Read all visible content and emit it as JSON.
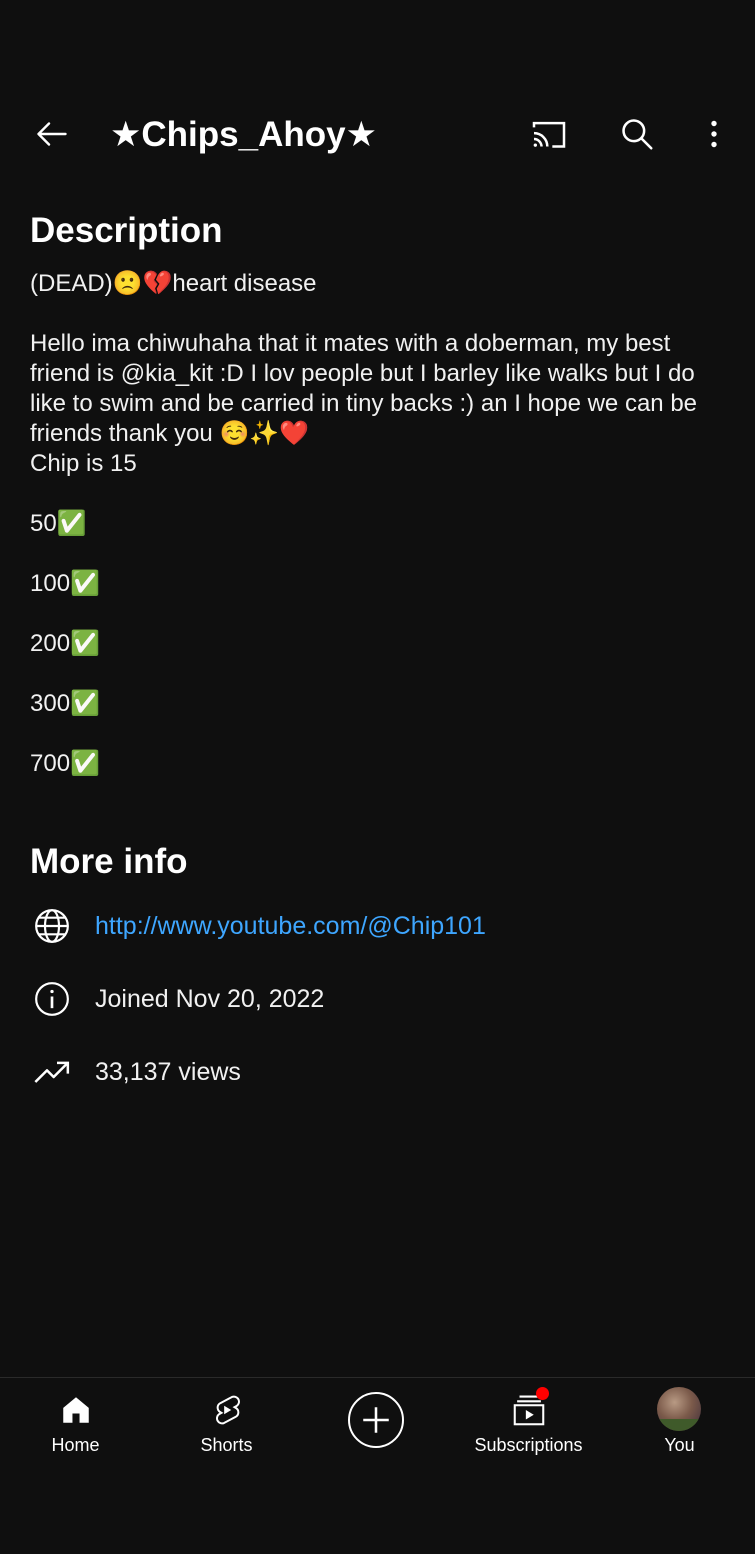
{
  "header": {
    "channel_title": "★Chips_Ahoy★",
    "icons": [
      "back-arrow-icon",
      "cast-icon",
      "search-icon",
      "more-vert-icon"
    ]
  },
  "description": {
    "title": "Description",
    "status_line": "(DEAD)🙁💔heart disease",
    "bio": "Hello ima chiwuhaha  that it mates with a doberman, my best friend  is @kia_kit :D I lov people but I barley  like walks but I do like to swim and be carried in tiny backs :) an I hope we can be friends  thank you ☺️✨❤️",
    "age_line": "Chip is 15",
    "milestones": [
      "50✅",
      "100✅",
      "200✅",
      "300✅",
      "700✅"
    ]
  },
  "more_info": {
    "title": "More info",
    "link": "http://www.youtube.com/@Chip101",
    "joined": "Joined Nov 20, 2022",
    "views": "33,137 views"
  },
  "bottom_nav": {
    "home": "Home",
    "shorts": "Shorts",
    "subscriptions": "Subscriptions",
    "you": "You"
  },
  "colors": {
    "background": "#0f0f0f",
    "link": "#3ea6ff",
    "notification": "#ff0000"
  }
}
